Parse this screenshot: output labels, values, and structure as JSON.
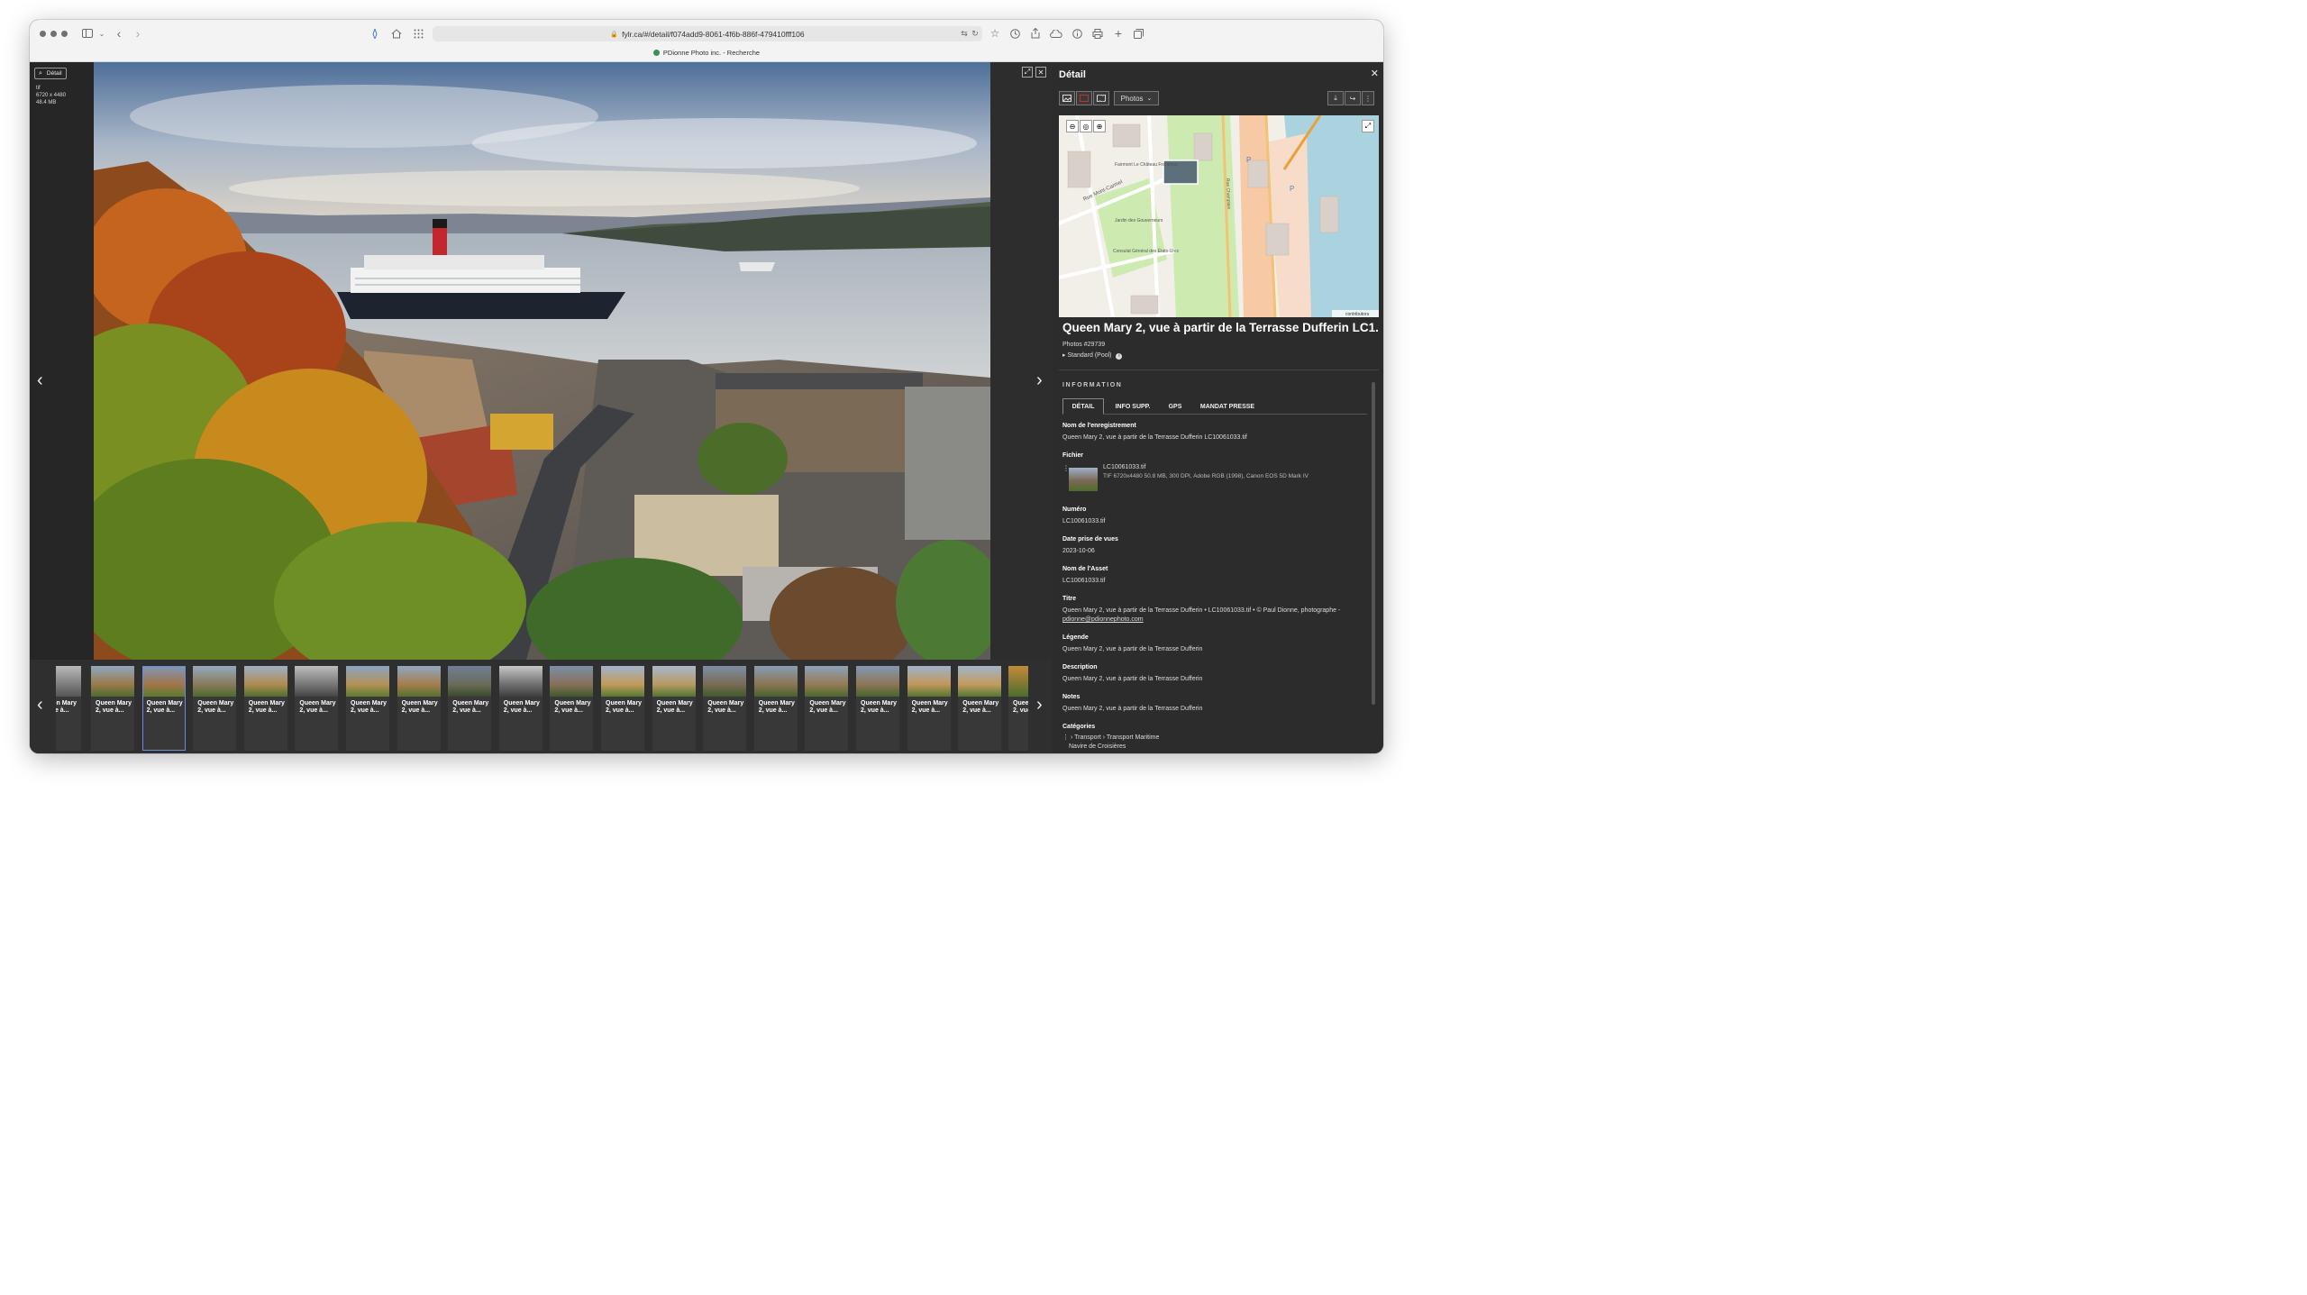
{
  "browser": {
    "url": "fylr.ca/#/detail/f074add9-8061-4f6b-886f-479410fff106",
    "tab_title": "PDionne Photo inc. - Recherche"
  },
  "viewer": {
    "detail_tab_label": "Détail",
    "format": "tif",
    "dimensions": "6720 x 4480",
    "size": "48.4 MB"
  },
  "thumbnails": [
    {
      "label": "Queen Mary 2, vue à..."
    },
    {
      "label": "Queen Mary 2, vue à..."
    },
    {
      "label": "Queen Mary 2, vue à..."
    },
    {
      "label": "Queen Mary 2, vue à..."
    },
    {
      "label": "Queen Mary 2, vue à..."
    },
    {
      "label": "Queen Mary 2, vue à..."
    },
    {
      "label": "Queen Mary 2, vue à..."
    },
    {
      "label": "Queen Mary 2, vue à..."
    },
    {
      "label": "Queen Mary 2, vue à..."
    },
    {
      "label": "Queen Mary 2, vue à..."
    },
    {
      "label": "Queen Mary 2, vue à..."
    },
    {
      "label": "Queen Mary 2, vue à..."
    },
    {
      "label": "Queen Mary 2, vue à..."
    },
    {
      "label": "Queen Mary 2, vue à..."
    },
    {
      "label": "Queen Mary 2, vue à..."
    },
    {
      "label": "Queen Mary 2, vue à..."
    },
    {
      "label": "Queen Mary 2, vue à..."
    },
    {
      "label": "Queen Mary 2, vue à..."
    }
  ],
  "thumb_edge_left": "Queen Mary 2, vue à...",
  "thumb_edge_right": "Queen Mary 2, vue à...",
  "panel": {
    "title": "Détail",
    "photos_dropdown": "Photos",
    "asset_title": "Queen Mary 2, vue à partir de la Terrasse Dufferin LC1...",
    "asset_number": "Photos #29739",
    "pool": "Standard (Pool)",
    "info_heading": "INFORMATION",
    "tabs": [
      "DÉTAIL",
      "INFO SUPP.",
      "GPS",
      "MANDAT PRESSE"
    ]
  },
  "map_labels": {
    "rue_mont_carmel": "Rue Mont-Carmel",
    "jardin": "Jardin des Gouverneurs",
    "consulat": "Consulat Général des États-Unis",
    "chateau": "Fairmont Le Château Frontenac",
    "champlain": "Rue Champlain",
    "attribution": "contributors",
    "p_sign": "P"
  },
  "fields": {
    "nom_label": "Nom de l'enregistrement",
    "nom_value": "Queen Mary 2, vue à partir de la Terrasse Dufferin LC10061033.tif",
    "fichier_label": "Fichier",
    "fichier_name": "LC10061033.tif",
    "fichier_meta": "TIF 6720x4480 50.8 MB, 300 DPI, Adobe RGB (1998), Canon EOS 5D Mark IV",
    "numero_label": "Numéro",
    "numero_value": "LC10061033.tif",
    "date_label": "Date prise de vues",
    "date_value": "2023-10-06",
    "asset_label": "Nom de l'Asset",
    "asset_value": "LC10061033.tif",
    "titre_label": "Titre",
    "titre_value": "Queen Mary 2, vue à partir de la Terrasse Dufferin • LC10061033.tif • © Paul Dionne, photographe -",
    "titre_email": "pdionne@pdionnephoto.com",
    "legende_label": "Légende",
    "legende_value": "Queen Mary 2, vue à partir de la Terrasse Dufferin",
    "description_label": "Description",
    "description_value": "Queen Mary 2, vue à partir de la Terrasse Dufferin",
    "notes_label": "Notes",
    "notes_value": "Queen Mary 2, vue à partir de la Terrasse Dufferin",
    "categories_label": "Catégories",
    "categories_path": "Transport › Transport Maritime",
    "categories_leaf": "Navire de Croisières"
  }
}
